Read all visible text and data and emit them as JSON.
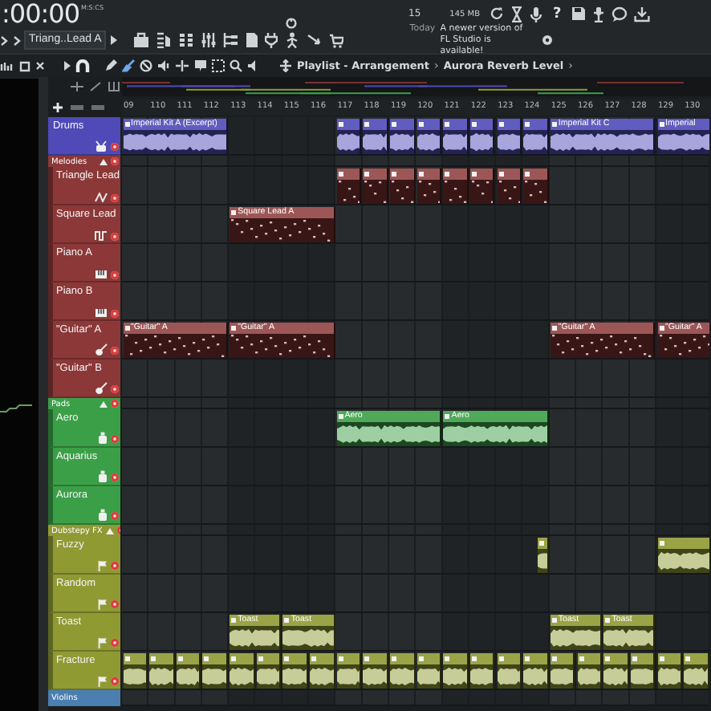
{
  "transport": {
    "time": ":00:00",
    "unit": "M:S:CS"
  },
  "pattern_selector": "Triang..Lead A",
  "meters": {
    "cpu": "15",
    "memory": "145 MB"
  },
  "help": "?",
  "news": {
    "date": "Today",
    "text": "A newer version of FL Studio is available!"
  },
  "playlist": {
    "title": "Playlist - Arrangement",
    "separator": "›",
    "breadcrumb": "Aurora Reverb Level",
    "end": "›"
  },
  "ruler": [
    "09",
    "110",
    "111",
    "112",
    "113",
    "114",
    "115",
    "116",
    "117",
    "118",
    "119",
    "120",
    "121",
    "122",
    "123",
    "124",
    "125",
    "126",
    "127",
    "128",
    "129",
    "130"
  ],
  "tracks": [
    {
      "kind": "drums",
      "name": "Drums",
      "color": "#4f4ab8",
      "clips": [
        {
          "kind": "audio",
          "label": "Imperial Kit A (Excerpt)"
        },
        {
          "kind": "audio"
        },
        {
          "kind": "audio"
        },
        {
          "kind": "audio"
        },
        {
          "kind": "audio"
        },
        {
          "kind": "audio"
        },
        {
          "kind": "audio"
        },
        {
          "kind": "audio"
        },
        {
          "kind": "audio"
        },
        {
          "kind": "audio",
          "label": "Imperial Kit C"
        },
        {
          "kind": "audio",
          "label": "Imperial"
        }
      ]
    },
    {
      "kind": "group",
      "name": "Melodies",
      "color": "#8c3838",
      "children": [
        {
          "kind": "triangle",
          "name": "Triangle Lead",
          "clips": [
            {
              "kind": "pattern"
            },
            {
              "kind": "pattern"
            },
            {
              "kind": "pattern"
            },
            {
              "kind": "pattern"
            },
            {
              "kind": "pattern"
            },
            {
              "kind": "pattern"
            },
            {
              "kind": "pattern"
            },
            {
              "kind": "pattern"
            }
          ]
        },
        {
          "kind": "square",
          "name": "Square Lead",
          "clips": [
            {
              "kind": "pattern",
              "label": "Square Lead A"
            }
          ]
        },
        {
          "kind": "piano",
          "name": "Piano A"
        },
        {
          "kind": "piano",
          "name": "Piano B"
        },
        {
          "kind": "guitar",
          "name": "\"Guitar\" A",
          "clips": [
            {
              "kind": "pattern",
              "label": "\"Guitar\" A"
            },
            {
              "kind": "pattern",
              "label": "\"Guitar\" A"
            },
            {
              "kind": "pattern",
              "label": "\"Guitar\" A"
            },
            {
              "kind": "pattern",
              "label": "\"Guitar\" A"
            }
          ]
        },
        {
          "kind": "guitar",
          "name": "\"Guitar\" B"
        }
      ]
    },
    {
      "kind": "group",
      "name": "Pads",
      "color": "#3b9f47",
      "children": [
        {
          "kind": "pad",
          "name": "Aero",
          "clips": [
            {
              "kind": "audio",
              "label": "Aero"
            },
            {
              "kind": "audio",
              "label": "Aero"
            }
          ]
        },
        {
          "kind": "pad",
          "name": "Aquarius"
        },
        {
          "kind": "pad",
          "name": "Aurora"
        }
      ]
    },
    {
      "kind": "group",
      "name": "Dubstepy FX",
      "color": "#8f9a33",
      "children": [
        {
          "kind": "fx",
          "name": "Fuzzy",
          "clips": [
            {
              "kind": "audio"
            },
            {
              "kind": "audio"
            }
          ]
        },
        {
          "kind": "fx",
          "name": "Random"
        },
        {
          "kind": "fx",
          "name": "Toast",
          "clips": [
            {
              "kind": "audio",
              "label": "Toast"
            },
            {
              "kind": "audio",
              "label": "Toast"
            },
            {
              "kind": "audio",
              "label": "Toast"
            },
            {
              "kind": "audio",
              "label": "Toast"
            }
          ]
        },
        {
          "kind": "fx",
          "name": "Fracture",
          "clips": [
            {
              "kind": "audio"
            },
            {
              "kind": "audio"
            },
            {
              "kind": "audio"
            },
            {
              "kind": "audio"
            },
            {
              "kind": "audio"
            },
            {
              "kind": "audio"
            },
            {
              "kind": "audio"
            },
            {
              "kind": "audio"
            },
            {
              "kind": "audio"
            },
            {
              "kind": "audio"
            },
            {
              "kind": "audio"
            },
            {
              "kind": "audio"
            },
            {
              "kind": "audio"
            },
            {
              "kind": "audio"
            },
            {
              "kind": "audio"
            },
            {
              "kind": "audio"
            },
            {
              "kind": "audio"
            },
            {
              "kind": "audio"
            },
            {
              "kind": "audio"
            },
            {
              "kind": "audio"
            },
            {
              "kind": "audio"
            },
            {
              "kind": "audio"
            }
          ]
        }
      ]
    },
    {
      "kind": "group",
      "name": "Violins",
      "color": "#4a7fb0"
    }
  ]
}
